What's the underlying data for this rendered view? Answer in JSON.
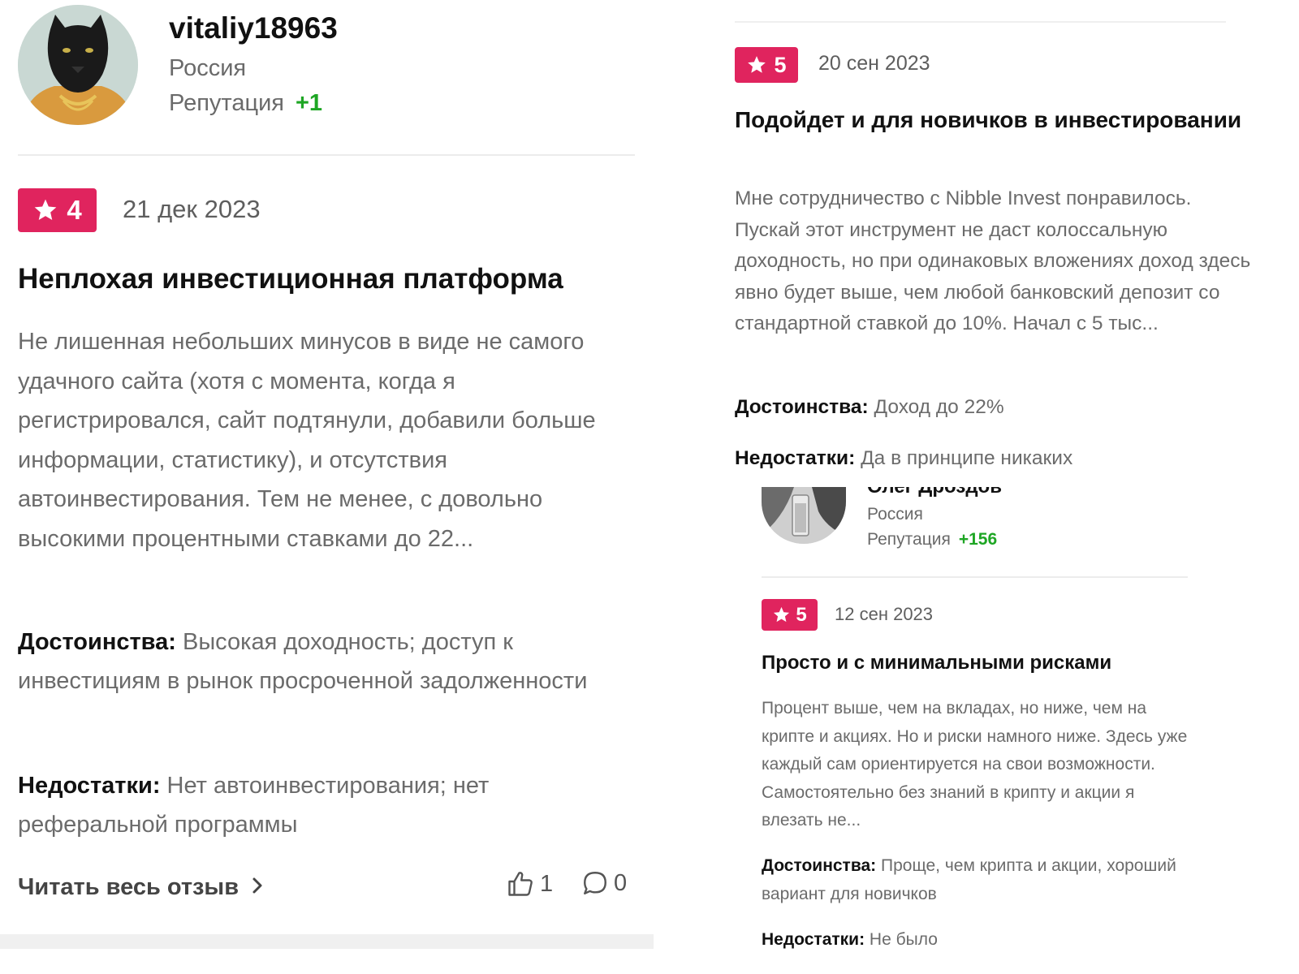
{
  "left_review": {
    "author": {
      "username": "vitaliy18963",
      "country": "Россия",
      "reputation_label": "Репутация",
      "reputation_value": "+1"
    },
    "rating": "4",
    "date": "21 дек 2023",
    "title": "Неплохая инвестиционная платформа",
    "text": "Не лишенная небольших минусов в виде не самого удачного сайта (хотя с момента, когда я регистрировался, сайт подтянули, добавили больше информации, статистику), и отсутствия автоинвестирования. Тем не менее, с довольно высокими процентными ставками до 22...",
    "pros_label": "Достоинства:",
    "pros": "Высокая доходность; доступ к инвестициям в рынок просроченной задолженности",
    "cons_label": "Недостатки:",
    "cons": "Нет автоинвестирования; нет реферальной программы",
    "read_more": "Читать весь отзыв",
    "likes": "1",
    "comments": "0"
  },
  "right_review_1": {
    "rating": "5",
    "date": "20 сен 2023",
    "title": "Подойдет и для новичков в инвестировании",
    "text": "Мне сотрудничество с Nibble Invest понравилось. Пускай этот инструмент не даст колоссальную доходность, но при одинаковых вложениях доход здесь явно будет выше, чем любой банковский депозит со стандартной ставкой до 10%. Начал с 5 тыс...",
    "pros_label": "Достоинства:",
    "pros": "Доход до 22%",
    "cons_label": "Недостатки:",
    "cons": "Да в принципе никаких"
  },
  "right_review_2": {
    "author": {
      "name": "Олег Дроздов",
      "country": "Россия",
      "reputation_label": "Репутация",
      "reputation_value": "+156"
    },
    "rating": "5",
    "date": "12 сен 2023",
    "title": "Просто и с минимальными рисками",
    "text": "Процент выше, чем на вкладах, но ниже, чем на крипте и акциях. Но и риски намного ниже. Здесь уже каждый сам ориентируется на свои возможности. Самостоятельно без знаний в крипту и акции я влезать не...",
    "pros_label": "Достоинства:",
    "pros": "Проще, чем крипта и акции, хороший вариант для новичков",
    "cons_label": "Недостатки:",
    "cons": "Не было"
  },
  "colors": {
    "badge": "#e0245e",
    "reputation": "#1ea624",
    "muted_text": "#6b6b6b"
  },
  "icons": [
    "star-icon",
    "thumbs-up-icon",
    "comment-icon",
    "chevron-right-icon"
  ]
}
